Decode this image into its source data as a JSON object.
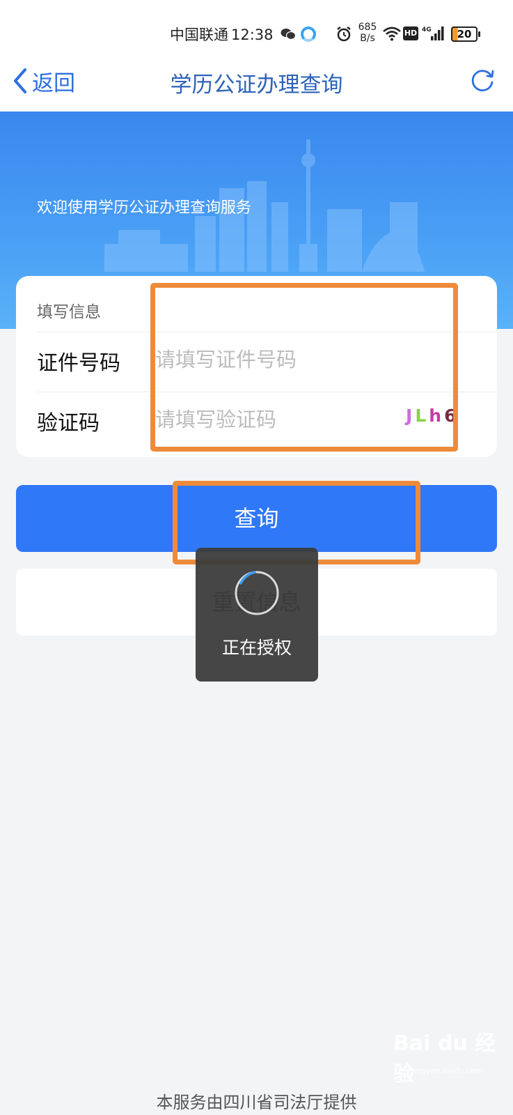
{
  "status_bar": {
    "carrier": "中国联通",
    "time": "12:38",
    "net_speed_value": "685",
    "net_speed_unit": "B/s",
    "hd": "HD",
    "network": "4G",
    "battery": "20"
  },
  "nav": {
    "back_label": "返回",
    "title": "学历公证办理查询"
  },
  "banner": {
    "welcome": "欢迎使用学历公证办理查询服务"
  },
  "form": {
    "header": "填写信息",
    "fields": [
      {
        "label": "证件号码",
        "placeholder": "请填写证件号码"
      },
      {
        "label": "验证码",
        "placeholder": "请填写验证码"
      }
    ],
    "captcha": [
      "J",
      "L",
      "h",
      "6"
    ]
  },
  "buttons": {
    "query": "查询",
    "reset": "重置信息"
  },
  "toast": {
    "text": "正在授权"
  },
  "footer": {
    "text": "本服务由四川省司法厅提供"
  },
  "watermark": {
    "brand": "Bai du 经验",
    "url": "jingyan.baidu.com"
  },
  "colors": {
    "primary": "#2f78f7",
    "banner": "#3a87ee",
    "highlight": "#ee8b3b",
    "background": "#f3f4f6"
  }
}
